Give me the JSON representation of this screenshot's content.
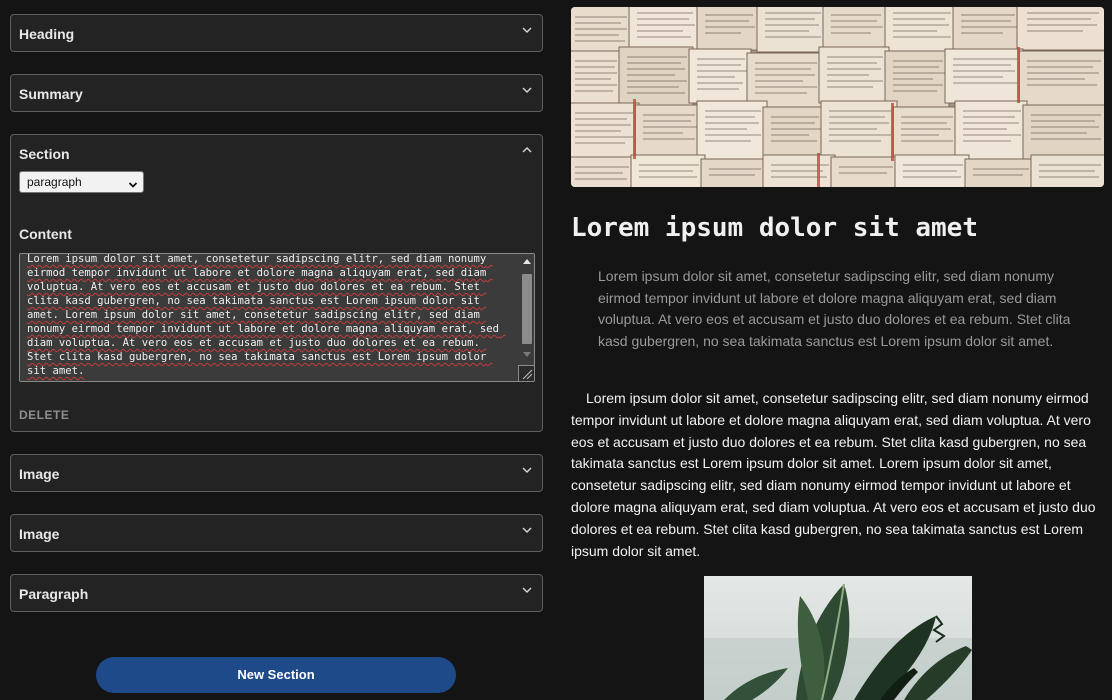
{
  "editor": {
    "panels_top": [
      {
        "title": "Heading"
      },
      {
        "title": "Summary"
      }
    ],
    "section": {
      "title": "Section",
      "select_value": "paragraph",
      "content_label": "Content",
      "content_text": "Lorem ipsum dolor sit amet, consetetur sadipscing elitr, sed diam nonumy eirmod tempor invidunt ut labore et dolore magna aliquyam erat, sed diam voluptua. At vero eos et accusam et justo duo dolores et ea rebum. Stet clita kasd gubergren, no sea takimata sanctus est Lorem ipsum dolor sit amet. Lorem ipsum dolor sit amet, consetetur sadipscing elitr, sed diam nonumy eirmod tempor invidunt ut labore et dolore magna aliquyam erat, sed diam voluptua. At vero eos et accusam et justo duo dolores et ea rebum. Stet clita kasd gubergren, no sea takimata sanctus est Lorem ipsum dolor sit amet.",
      "delete_label": "DELETE"
    },
    "panels_bottom": [
      {
        "title": "Image"
      },
      {
        "title": "Image"
      },
      {
        "title": "Paragraph"
      }
    ],
    "new_section_label": "New Section"
  },
  "preview": {
    "title": "Lorem ipsum dolor sit amet",
    "summary": "Lorem ipsum dolor sit amet, consetetur sadipscing elitr, sed diam nonumy eirmod tempor invidunt ut labore et dolore magna aliquyam erat, sed diam voluptua. At vero eos et accusam et justo duo dolores et ea rebum. Stet clita kasd gubergren, no sea takimata sanctus est Lorem ipsum dolor sit amet.",
    "paragraph": "Lorem ipsum dolor sit amet, consetetur sadipscing elitr, sed diam nonumy eirmod tempor invidunt ut labore et dolore magna aliquyam erat, sed diam voluptua. At vero eos et accusam et justo duo dolores et ea rebum. Stet clita kasd gubergren, no sea takimata sanctus est Lorem ipsum dolor sit amet. Lorem ipsum dolor sit amet, consetetur sadipscing elitr, sed diam nonumy eirmod tempor invidunt ut labore et dolore magna aliquyam erat, sed diam voluptua. At vero eos et accusam et justo duo dolores et ea rebum. Stet clita kasd gubergren, no sea takimata sanctus est Lorem ipsum dolor sit amet."
  },
  "icons": {
    "collapsed": "chevron-down-icon",
    "expanded": "chevron-up-icon"
  },
  "colors": {
    "background": "#141414",
    "panel": "#232323",
    "accent_button": "#1e4a8a"
  }
}
